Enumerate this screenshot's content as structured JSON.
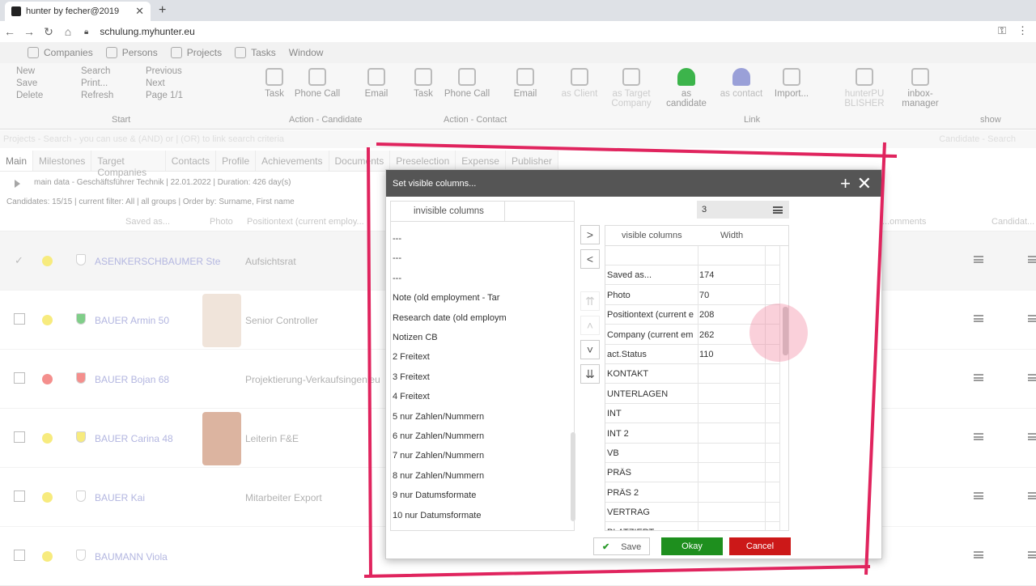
{
  "browser": {
    "tab_title": "hunter by fecher@2019",
    "url": "schulung.myhunter.eu"
  },
  "appnav": [
    "Companies",
    "Persons",
    "Projects",
    "Tasks",
    "Window"
  ],
  "ribbon": {
    "start": [
      "New",
      "Save",
      "Delete"
    ],
    "start2": [
      "Search",
      "Print...",
      "Refresh"
    ],
    "start3": [
      "Previous",
      "Next",
      "Page 1/1"
    ],
    "btns": [
      "Task",
      "Phone Call",
      "Email",
      "Task",
      "Phone Call",
      "Email",
      "as Client",
      "as Target Company",
      "as candidate",
      "as contact",
      "Import...",
      "hunterPU BLISHER",
      "inbox-manager"
    ],
    "groups": [
      "Start",
      "Action - Candidate",
      "Action - Contact",
      "Link",
      "show"
    ]
  },
  "search": {
    "placeholder": "Projects - Search - you can use & (AND) or | (OR) to link search criteria",
    "right": "Candidate - Search"
  },
  "ptabs": [
    "Main",
    "Milestones",
    "Target Companies",
    "Contacts",
    "Profile",
    "Achievements",
    "Documents",
    "Preselection",
    "Expense",
    "Publisher"
  ],
  "info": "main data - Geschäftsführer Technik | 22.01.2022 | Duration: 426 day(s)",
  "info2": "Candidates: 15/15 | current filter: All | all groups | Order by: Surname, First name",
  "grid": {
    "headers": [
      "Saved as...",
      "Photo",
      "Positiontext (current employ...",
      "...omments",
      "Candidat..."
    ],
    "rows": [
      {
        "name": "ASENKERSCHBAUMER Ste",
        "pos": "Aufsichtsrat",
        "dot": "#f3e03a",
        "shield": "#ffffff"
      },
      {
        "name": "BAUER Armin 50",
        "pos": "Senior Controller",
        "dot": "#f3e03a",
        "shield": "#3cb44b"
      },
      {
        "name": "BAUER Bojan 68",
        "pos": "Projektierung-Verkaufsingenieu",
        "dot": "#ef5350",
        "shield": "#ef5350"
      },
      {
        "name": "BAUER Carina 48",
        "pos": "Leiterin F&E",
        "dot": "#f3e03a",
        "shield": "#f3e03a"
      },
      {
        "name": "BAUER Kai",
        "pos": "Mitarbeiter Export",
        "dot": "#f3e03a",
        "shield": "#ffffff"
      },
      {
        "name": "BAUMANN Viola",
        "pos": "",
        "dot": "#f3e03a",
        "shield": "#ffffff"
      }
    ]
  },
  "dialog": {
    "title": "Set visible columns...",
    "inv_header": "invisible columns",
    "inv_items": [
      "---",
      "---",
      "---",
      "Note (old employment - Tar",
      "Research date (old employm",
      "Notizen CB",
      "2 Freitext",
      "3 Freitext",
      "4 Freitext",
      "5 nur Zahlen/Nummern",
      "6 nur Zahlen/Nummern",
      "7 nur Zahlen/Nummern",
      "8 nur Zahlen/Nummern",
      "9 nur Datumsformate",
      "10 nur Datumsformate"
    ],
    "count": "3",
    "vis_header": "visible columns",
    "width_header": "Width",
    "vis_rows": [
      {
        "name": "",
        "w": ""
      },
      {
        "name": "Saved as...",
        "w": "174"
      },
      {
        "name": "Photo",
        "w": "70"
      },
      {
        "name": "Positiontext (current e",
        "w": "208"
      },
      {
        "name": "Company (current em",
        "w": "262"
      },
      {
        "name": "act.Status",
        "w": "110"
      },
      {
        "name": "KONTAKT",
        "w": ""
      },
      {
        "name": "UNTERLAGEN",
        "w": ""
      },
      {
        "name": "INT",
        "w": ""
      },
      {
        "name": "INT 2",
        "w": ""
      },
      {
        "name": "VB",
        "w": ""
      },
      {
        "name": "PRÄS",
        "w": ""
      },
      {
        "name": "PRÄS 2",
        "w": ""
      },
      {
        "name": "VERTRAG",
        "w": ""
      },
      {
        "name": "PLATZIERT",
        "w": ""
      }
    ],
    "save": "Save",
    "okay": "Okay",
    "cancel": "Cancel"
  },
  "colors": {
    "accent_frame": "#e0245e",
    "okay": "#1e8f1e",
    "cancel": "#cc1818"
  }
}
